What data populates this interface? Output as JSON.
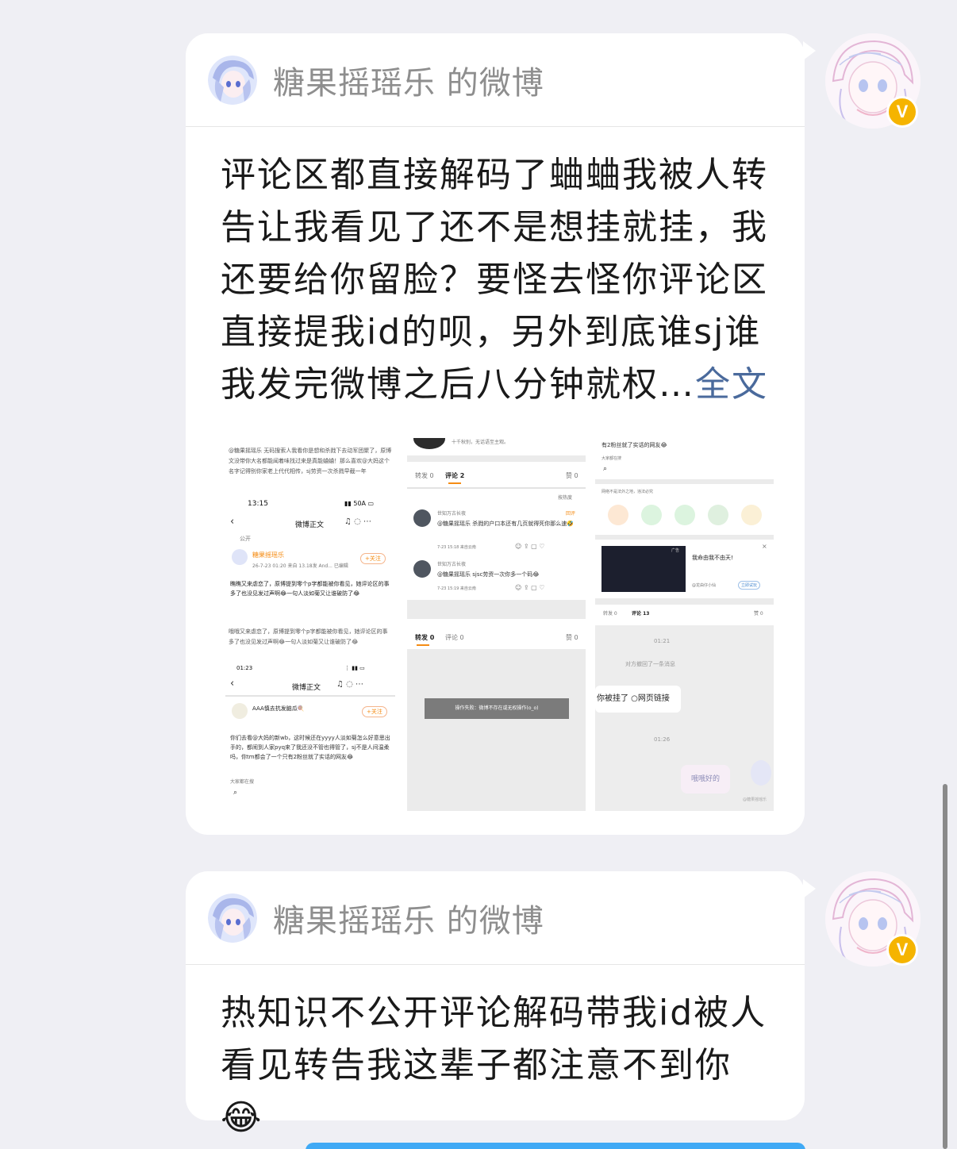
{
  "messages": [
    {
      "source_name": "糖果摇瑶乐 的微博",
      "text": "评论区都直接解码了蛐蛐我被人转告让我看见了还不是想挂就挂，我还要给你留脸？要怪去怪你评论区直接提我id的呗，另外到底谁sj谁我发完微博之后八分钟就权…",
      "more_label": "全文",
      "screenshots": {
        "left": {
          "caption_top": "@糖果摇瑶乐 无码搜索人我看你是想和杀戮下去动军团聚了，原博文没带你大名都能闻着味找过来是真能蛐蛐！那么喜欢@大妈这个名字记得别你家老上代代相传，sj劳资一次杀戮早截一年",
          "time1": "13:15",
          "nav1": "微博正文",
          "public_label": "公开",
          "poster1": "糖果摇瑶乐",
          "follow1": "+关注",
          "date1": "26-7-23 01:20  来自 13.18发 And...  已编辑",
          "body1": "瞧瞧又来虐恋了，原博提到零个p字都能被你看见，她评论区的事多了也没见发过声啊😂一句人淡如菊又让谁破防了😂",
          "caption_mid": "哦哦又来虐恋了，原博提到零个p字都能被你看见，她评论区的事多了也没见发过声啊😂一句人淡如菊又让谁破防了😂",
          "time2": "01:23",
          "nav2": "微博正文",
          "poster2": "AAA慎去抗发脑瓜🍭",
          "follow2": "+关注",
          "body2": "你们去看@大妈的新wb，这时候还在yyyy人淡如菊怎么好意思出手的，都闹到人家pyq来了我还没不管也得管了，sj不是人间温柔吗，你tm都会了一个只有2粉丝就了实话的网友😂",
          "footer2": "大家都在搜"
        },
        "middle": {
          "top_text": "十千秋别，无话语至主观。",
          "tab_repost": "转发 0",
          "tab_comment": "评论 2",
          "tab_like": "赞 0",
          "sort_label": "按热度",
          "c1_user": "世知万古长夜",
          "c1_tag": "回评",
          "c1_text": "@糖果摇瑶乐 杀戮的户口本还有几页就得死你那么速🤣",
          "c1_time": "7-23 15:18  来自云南",
          "c2_user": "世知万古长夜",
          "c2_text": "@糖果摇瑶乐 sjsc劳资一次你多一个码😂",
          "c2_time": "7-23 15:19  来自云南",
          "tab2_repost": "转发 0",
          "tab2_comment": "评论 0",
          "tab2_like": "赞 0",
          "error_msg": "操作失败：微博不存在或无权操作(o_o)"
        },
        "right": {
          "top_text": "有2粉丝就了实话的网友😂",
          "sub_text": "大家都在搜",
          "share_hint": "网络不是法外之地，违法必究",
          "ad_label": "广告",
          "ad_title": "我命由我不由天!",
          "ad_source": "@龙由仔小仙",
          "ad_button": "立即试玩",
          "tab_repost": "转发 0",
          "tab_comment": "评论 13",
          "tab_like": "赞 0",
          "chat_time1": "01:21",
          "chat_notice": "对方撤回了一条消息",
          "chat_bubble": "你被挂了 ○网页链接",
          "chat_time2": "01:26",
          "chat_sticker": "哦哦好的",
          "watermark": "@糖果摇瑶乐"
        }
      }
    },
    {
      "source_name": "糖果摇瑶乐 的微博",
      "text": "热知识不公开评论解码带我id被人看见转告我这辈子都注意不到你",
      "emoji": "😂"
    }
  ],
  "colors": {
    "page_bg": "#efeff4",
    "card_bg": "#ffffff",
    "link": "#4a6a9c",
    "verified": "#f5b400",
    "accent_orange": "#f58c14"
  },
  "icons": [
    "anime-avatar-icon",
    "verified-badge-icon",
    "share-weibo-icon",
    "share-wechat-icon",
    "share-moments-icon",
    "share-qq-icon",
    "share-qzone-icon"
  ]
}
